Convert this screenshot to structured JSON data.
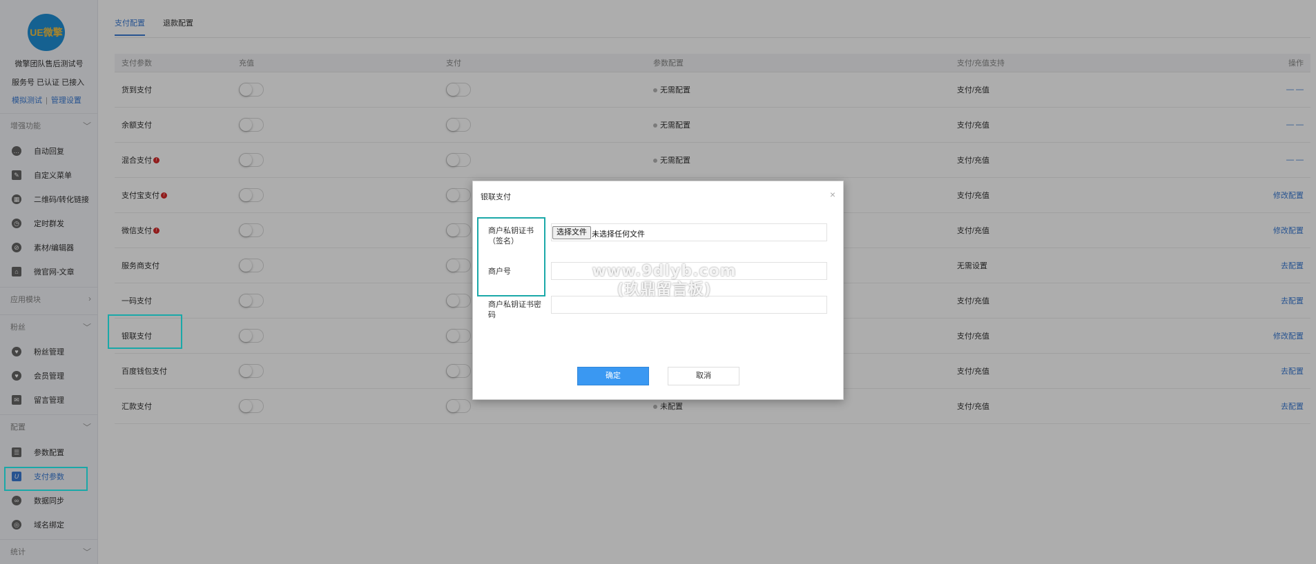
{
  "colors": {
    "accent": "#3a7bd5",
    "highlight": "#19a8a8",
    "primary_button": "#3a98f2",
    "warning": "#d62828"
  },
  "sidebar": {
    "logo_text": "UE微擎",
    "account_name": "微擎团队售后测试号",
    "account_status": "服务号 已认证 已接入",
    "link_test": "模拟测试",
    "link_separator": "|",
    "link_manage": "管理设置",
    "groups": {
      "zengqiang": {
        "label": "增强功能",
        "items": [
          {
            "label": "自动回复",
            "icon": "chat-icon"
          },
          {
            "label": "自定义菜单",
            "icon": "menu-edit-icon"
          },
          {
            "label": "二维码/转化链接",
            "icon": "qrcode-icon"
          },
          {
            "label": "定时群发",
            "icon": "clock-icon"
          },
          {
            "label": "素材/编辑器",
            "icon": "compass-icon"
          },
          {
            "label": "微官网-文章",
            "icon": "home-icon"
          }
        ]
      },
      "yingyong": {
        "label": "应用模块"
      },
      "fensi": {
        "label": "粉丝",
        "items": [
          {
            "label": "粉丝管理",
            "icon": "heart-icon"
          },
          {
            "label": "会员管理",
            "icon": "heart-icon"
          },
          {
            "label": "留言管理",
            "icon": "mail-icon"
          }
        ]
      },
      "peizhi": {
        "label": "配置",
        "items": [
          {
            "label": "参数配置",
            "icon": "list-icon"
          },
          {
            "label": "支付参数",
            "icon": "payment-icon"
          },
          {
            "label": "数据同步",
            "icon": "link-icon"
          },
          {
            "label": "域名绑定",
            "icon": "globe-icon"
          }
        ]
      },
      "tongji": {
        "label": "统计"
      }
    }
  },
  "tabs": [
    {
      "label": "支付配置"
    },
    {
      "label": "退款配置"
    }
  ],
  "table": {
    "headers": [
      "支付参数",
      "充值",
      "支付",
      "参数配置",
      "支付/充值支持",
      "操作"
    ],
    "rows": [
      {
        "name": "货到支付",
        "config": "无需配置",
        "support": "支付/充值",
        "op": "— —"
      },
      {
        "name": "余额支付",
        "config": "无需配置",
        "support": "支付/充值",
        "op": "— —"
      },
      {
        "name": "混合支付",
        "config": "无需配置",
        "support": "支付/充值",
        "op": "— —"
      },
      {
        "name": "支付宝支付",
        "config": "",
        "support": "支付/充值",
        "op": "修改配置"
      },
      {
        "name": "微信支付",
        "config": "",
        "support": "支付/充值",
        "op": "修改配置"
      },
      {
        "name": "服务商支付",
        "config": "",
        "support": "无需设置",
        "op": "去配置"
      },
      {
        "name": "一码支付",
        "config": "",
        "support": "支付/充值",
        "op": "去配置"
      },
      {
        "name": "银联支付",
        "config": "",
        "support": "支付/充值",
        "op": "修改配置"
      },
      {
        "name": "百度钱包支付",
        "config": "",
        "support": "支付/充值",
        "op": "去配置"
      },
      {
        "name": "汇款支付",
        "config": "未配置",
        "support": "支付/充值",
        "op": "去配置"
      }
    ],
    "warn_mark": "!"
  },
  "modal": {
    "title": "银联支付",
    "close": "×",
    "field_cert_label": "商户私钥证书（签名）",
    "file_button": "选择文件",
    "file_status": "未选择任何文件",
    "field_merchant_label": "商户号",
    "field_cert_pwd_label": "商户私钥证书密码",
    "ok_label": "确定",
    "cancel_label": "取消"
  },
  "watermark": {
    "line1": "www.9dlyb.com",
    "line2": "(玖鼎留言板)"
  }
}
